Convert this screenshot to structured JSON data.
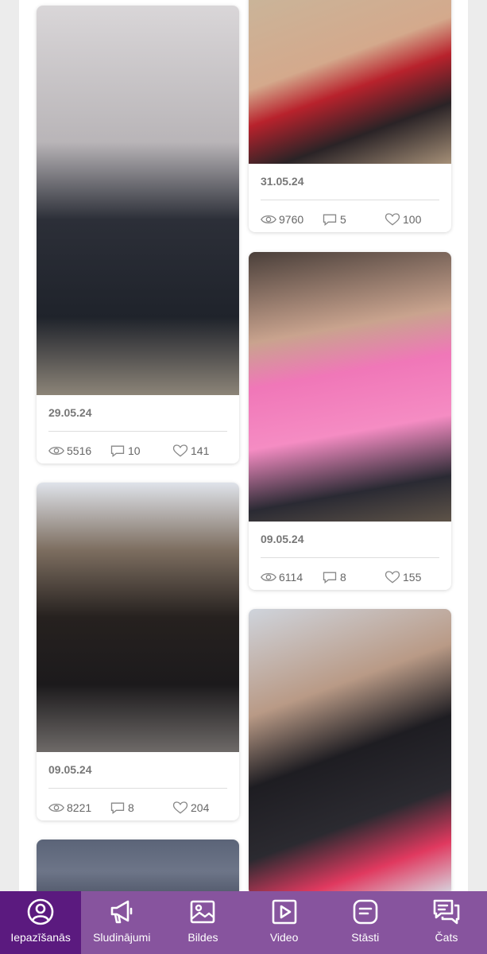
{
  "colors": {
    "nav_bg": "#87549e",
    "nav_active_bg": "#5b1a7f",
    "card_bg": "#ffffff",
    "meta_text": "#777777"
  },
  "feed": {
    "cards": [
      {
        "id": "card-1",
        "date": "",
        "views": "",
        "comments": "",
        "likes": "",
        "photo_label": ""
      },
      {
        "id": "card-2",
        "date": "31.05.24",
        "views": "9760",
        "comments": "5",
        "likes": "100",
        "photo_label": ""
      },
      {
        "id": "card-3",
        "date": "29.05.24",
        "views": "5516",
        "comments": "10",
        "likes": "141",
        "photo_label": ""
      },
      {
        "id": "card-4",
        "date": "09.05.24",
        "views": "6114",
        "comments": "8",
        "likes": "155",
        "photo_label": ""
      },
      {
        "id": "card-5",
        "date": "09.05.24",
        "views": "8221",
        "comments": "8",
        "likes": "204",
        "photo_label": ""
      },
      {
        "id": "card-6",
        "date": "",
        "views": "",
        "comments": "",
        "likes": "",
        "photo_label": ""
      },
      {
        "id": "card-7",
        "date": "",
        "views": "",
        "comments": "",
        "likes": "",
        "photo_label": ""
      }
    ]
  },
  "bottom_nav": {
    "items": [
      {
        "label": "Iepazīšanās",
        "icon": "profile-icon",
        "active": true
      },
      {
        "label": "Sludinājumi",
        "icon": "megaphone-icon",
        "active": false
      },
      {
        "label": "Bildes",
        "icon": "image-icon",
        "active": false
      },
      {
        "label": "Video",
        "icon": "video-icon",
        "active": false
      },
      {
        "label": "Stāsti",
        "icon": "stories-icon",
        "active": false
      },
      {
        "label": "Čats",
        "icon": "chat-icon",
        "active": false
      }
    ]
  }
}
